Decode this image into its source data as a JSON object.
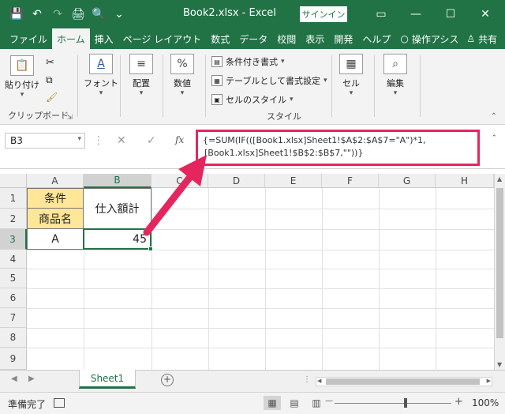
{
  "window": {
    "title": "Book2.xlsx  -  Excel",
    "signin_label": "サインイン",
    "controls": [
      "▭",
      "—",
      "☐",
      "✕"
    ]
  },
  "qat": [
    "💾",
    "↶",
    "↷",
    "🖨",
    "🔍",
    "⌄"
  ],
  "tabs": [
    "ファイル",
    "ホーム",
    "挿入",
    "ページ レイアウト",
    "数式",
    "データ",
    "校閲",
    "表示",
    "開発",
    "ヘルプ"
  ],
  "tabs_right": {
    "tell_me": "操作アシス",
    "share": "共有"
  },
  "ribbon": {
    "paste_label": "貼り付け",
    "clipboard_label": "クリップボード",
    "font_label": "フォント",
    "align_label": "配置",
    "number_label": "数値",
    "cond_format_label": "条件付き書式",
    "table_format_label": "テーブルとして書式設定",
    "cell_style_label": "セルのスタイル",
    "style_group_label": "スタイル",
    "cell_label": "セル",
    "edit_label": "編集"
  },
  "formula_bar": {
    "name_box": "B3",
    "fx": "fx",
    "formula_line1": "{=SUM(IF(([Book1.xlsx]Sheet1!$A$2:$A$7=\"A\")*1,",
    "formula_line2": "[Book1.xlsx]Sheet1!$B$2:$B$7,\"\"))}"
  },
  "grid": {
    "columns": [
      "A",
      "B",
      "C",
      "D",
      "E",
      "F",
      "G",
      "H"
    ],
    "rows": [
      "1",
      "2",
      "3",
      "4",
      "5",
      "6",
      "7",
      "8",
      "9"
    ],
    "cells": {
      "a1": "条件",
      "a2": "商品名",
      "b12": "仕入額計",
      "a3": "A",
      "b3": "45"
    },
    "highlight_color": "#ffe699"
  },
  "sheet_tabs": [
    "Sheet1"
  ],
  "status": {
    "ready": "準備完了",
    "zoom": "100%",
    "minus": "—",
    "plus": "+"
  },
  "accent_color": "#217346",
  "annotation_color": "#e5265e"
}
